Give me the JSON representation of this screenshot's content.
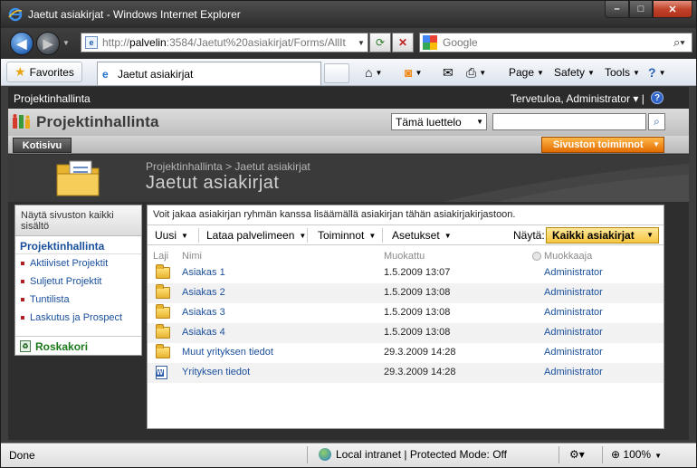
{
  "window": {
    "title": "Jaetut asiakirjat - Windows Internet Explorer",
    "minimize": "–",
    "maximize": "□",
    "close": "✕"
  },
  "browser": {
    "url_gray": "http://",
    "url_host": "palvelin",
    "url_rest": ":3584/Jaetut%20asiakirjat/Forms/AllIt",
    "search_placeholder": "Google",
    "favorites_label": "Favorites",
    "tab_title": "Jaetut asiakirjat",
    "commands": {
      "page": "Page",
      "safety": "Safety",
      "tools": "Tools",
      "help": "?"
    }
  },
  "sharepoint": {
    "site_top": "Projektinhallinta",
    "welcome": "Tervetuloa, Administrator",
    "help": "?",
    "site_name": "Projektinhallinta",
    "scope": "Tämä luettelo",
    "home_tab": "Kotisivu",
    "site_actions": "Sivuston toiminnot",
    "breadcrumb": "Projektinhallinta > Jaetut asiakirjat",
    "page_title": "Jaetut asiakirjat"
  },
  "left_nav": {
    "view_all": "Näytä sivuston kaikki sisältö",
    "heading": "Projektinhallinta",
    "items": [
      {
        "label": "Aktiiviset Projektit"
      },
      {
        "label": "Suljetut Projektit"
      },
      {
        "label": "Tuntilista"
      },
      {
        "label": "Laskutus ja Prospect"
      }
    ],
    "recycle_bin": "Roskakori"
  },
  "library": {
    "intro": "Voit jakaa asiakirjan ryhmän kanssa lisäämällä asiakirjan tähän asiakirjakirjastoon.",
    "toolbar": {
      "new": "Uusi",
      "upload": "Lataa palvelimeen",
      "actions": "Toiminnot",
      "settings": "Asetukset",
      "view_label": "Näytä:",
      "view_value": "Kaikki asiakirjat"
    },
    "columns": {
      "type": "Laji",
      "name": "Nimi",
      "modified": "Muokattu",
      "editor": "Muokkaaja"
    },
    "rows": [
      {
        "type": "folder",
        "name": "Asiakas 1",
        "modified": "1.5.2009 13:07",
        "editor": "Administrator"
      },
      {
        "type": "folder",
        "name": "Asiakas 2",
        "modified": "1.5.2009 13:08",
        "editor": "Administrator"
      },
      {
        "type": "folder",
        "name": "Asiakas 3",
        "modified": "1.5.2009 13:08",
        "editor": "Administrator"
      },
      {
        "type": "folder",
        "name": "Asiakas 4",
        "modified": "1.5.2009 13:08",
        "editor": "Administrator"
      },
      {
        "type": "folder",
        "name": "Muut yrityksen tiedot",
        "modified": "29.3.2009 14:28",
        "editor": "Administrator"
      },
      {
        "type": "document",
        "name": "Yrityksen tiedot",
        "modified": "29.3.2009 14:28",
        "editor": "Administrator"
      }
    ]
  },
  "status": {
    "done": "Done",
    "zone": "Local intranet | Protected Mode: Off",
    "zoom": "100%"
  }
}
